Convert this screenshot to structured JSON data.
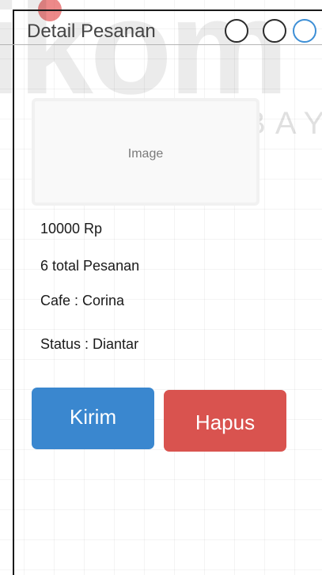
{
  "watermark": {
    "logo_text": "ikom",
    "sub_text": "SURABAYA"
  },
  "window": {
    "title": "Detail Pesanan",
    "buttons": [
      "circle-button",
      "circle-button",
      "circle-button-active"
    ]
  },
  "product": {
    "image_label": "Image",
    "price": "10000 Rp",
    "total": "6 total Pesanan",
    "cafe": "Cafe : Corina",
    "status": "Status : Diantar"
  },
  "actions": {
    "kirim_label": "Kirim",
    "hapus_label": "Hapus"
  },
  "colors": {
    "kirim": "#3a87cf",
    "hapus": "#d9534f",
    "active_window_button": "#3d8fd6"
  }
}
